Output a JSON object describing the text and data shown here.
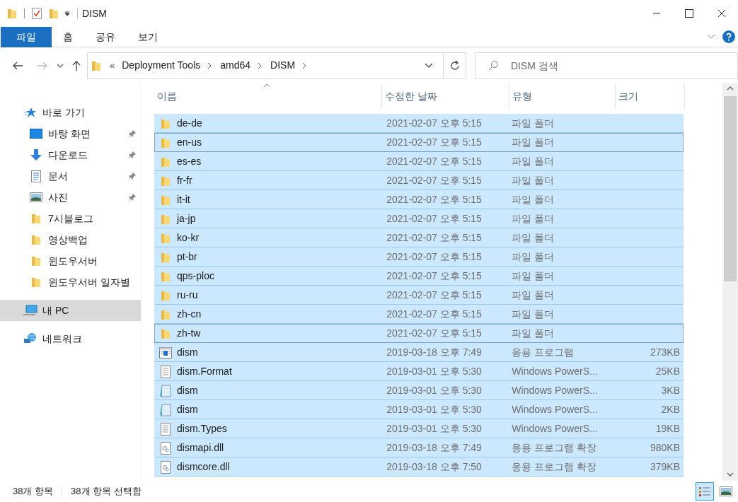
{
  "window": {
    "title": "DISM"
  },
  "ribbon_tabs": [
    {
      "label": "파일",
      "selected": true
    },
    {
      "label": "홈",
      "selected": false
    },
    {
      "label": "공유",
      "selected": false
    },
    {
      "label": "보기",
      "selected": false
    }
  ],
  "address": {
    "overflow": "«",
    "crumbs": [
      "Deployment Tools",
      "amd64",
      "DISM"
    ]
  },
  "search": {
    "placeholder": "DISM 검색"
  },
  "sidebar": {
    "items": [
      {
        "label": "바로 가기",
        "kind": "quick",
        "pinned": false,
        "selected": false,
        "children": [
          {
            "label": "바탕 화면",
            "kind": "desktop",
            "pinned": true,
            "selected": false
          },
          {
            "label": "다운로드",
            "kind": "download",
            "pinned": true,
            "selected": false
          },
          {
            "label": "문서",
            "kind": "document",
            "pinned": true,
            "selected": false
          },
          {
            "label": "사진",
            "kind": "picture",
            "pinned": true,
            "selected": false
          },
          {
            "label": "7시블로그",
            "kind": "folder",
            "pinned": false,
            "selected": false
          },
          {
            "label": "영상백업",
            "kind": "folder",
            "pinned": false,
            "selected": false
          },
          {
            "label": "윈도우서버",
            "kind": "folder",
            "pinned": false,
            "selected": false
          },
          {
            "label": "윈도우서버 일자별",
            "kind": "folder",
            "pinned": false,
            "selected": false
          }
        ]
      },
      {
        "label": "내 PC",
        "kind": "pc",
        "pinned": false,
        "selected": true
      },
      {
        "label": "네트워크",
        "kind": "network",
        "pinned": false,
        "selected": false
      }
    ]
  },
  "table": {
    "columns": [
      "이름",
      "수정한 날짜",
      "유형",
      "크기"
    ],
    "rows": [
      {
        "kind": "folder",
        "name": "de-de",
        "date": "2021-02-07 오후 5:15",
        "type": "파일 폴더",
        "size": "",
        "selected": true,
        "focused": false
      },
      {
        "kind": "folder",
        "name": "en-us",
        "date": "2021-02-07 오후 5:15",
        "type": "파일 폴더",
        "size": "",
        "selected": true,
        "focused": true
      },
      {
        "kind": "folder",
        "name": "es-es",
        "date": "2021-02-07 오후 5:15",
        "type": "파일 폴더",
        "size": "",
        "selected": true,
        "focused": false
      },
      {
        "kind": "folder",
        "name": "fr-fr",
        "date": "2021-02-07 오후 5:15",
        "type": "파일 폴더",
        "size": "",
        "selected": true,
        "focused": false
      },
      {
        "kind": "folder",
        "name": "it-it",
        "date": "2021-02-07 오후 5:15",
        "type": "파일 폴더",
        "size": "",
        "selected": true,
        "focused": false
      },
      {
        "kind": "folder",
        "name": "ja-jp",
        "date": "2021-02-07 오후 5:15",
        "type": "파일 폴더",
        "size": "",
        "selected": true,
        "focused": false
      },
      {
        "kind": "folder",
        "name": "ko-kr",
        "date": "2021-02-07 오후 5:15",
        "type": "파일 폴더",
        "size": "",
        "selected": true,
        "focused": false
      },
      {
        "kind": "folder",
        "name": "pt-br",
        "date": "2021-02-07 오후 5:15",
        "type": "파일 폴더",
        "size": "",
        "selected": true,
        "focused": false
      },
      {
        "kind": "folder",
        "name": "qps-ploc",
        "date": "2021-02-07 오후 5:15",
        "type": "파일 폴더",
        "size": "",
        "selected": true,
        "focused": false
      },
      {
        "kind": "folder",
        "name": "ru-ru",
        "date": "2021-02-07 오후 5:15",
        "type": "파일 폴더",
        "size": "",
        "selected": true,
        "focused": false
      },
      {
        "kind": "folder",
        "name": "zh-cn",
        "date": "2021-02-07 오후 5:15",
        "type": "파일 폴더",
        "size": "",
        "selected": true,
        "focused": false
      },
      {
        "kind": "folder",
        "name": "zh-tw",
        "date": "2021-02-07 오후 5:15",
        "type": "파일 폴더",
        "size": "",
        "selected": true,
        "focused": true
      },
      {
        "kind": "exe",
        "name": "dism",
        "date": "2019-03-18 오후 7:49",
        "type": "응용 프로그램",
        "size": "273KB",
        "selected": true,
        "focused": false
      },
      {
        "kind": "text",
        "name": "dism.Format",
        "date": "2019-03-01 오후 5:30",
        "type": "Windows PowerS...",
        "size": "25KB",
        "selected": true,
        "focused": false
      },
      {
        "kind": "script",
        "name": "dism",
        "date": "2019-03-01 오후 5:30",
        "type": "Windows PowerS...",
        "size": "3KB",
        "selected": true,
        "focused": false
      },
      {
        "kind": "script",
        "name": "dism",
        "date": "2019-03-01 오후 5:30",
        "type": "Windows PowerS...",
        "size": "2KB",
        "selected": true,
        "focused": false
      },
      {
        "kind": "text",
        "name": "dism.Types",
        "date": "2019-03-01 오후 5:30",
        "type": "Windows PowerS...",
        "size": "19KB",
        "selected": true,
        "focused": false
      },
      {
        "kind": "dll",
        "name": "dismapi.dll",
        "date": "2019-03-18 오후 7:49",
        "type": "응용 프로그램 확장",
        "size": "980KB",
        "selected": true,
        "focused": false
      },
      {
        "kind": "dll",
        "name": "dismcore.dll",
        "date": "2019-03-18 오후 7:50",
        "type": "응용 프로그램 확장",
        "size": "379KB",
        "selected": true,
        "focused": false
      }
    ]
  },
  "status_bar": {
    "count": "38개 항목",
    "selection": "38개 항목 선택함"
  },
  "view_buttons": [
    {
      "kind": "details",
      "selected": true
    },
    {
      "kind": "thumbnails",
      "selected": false
    }
  ]
}
